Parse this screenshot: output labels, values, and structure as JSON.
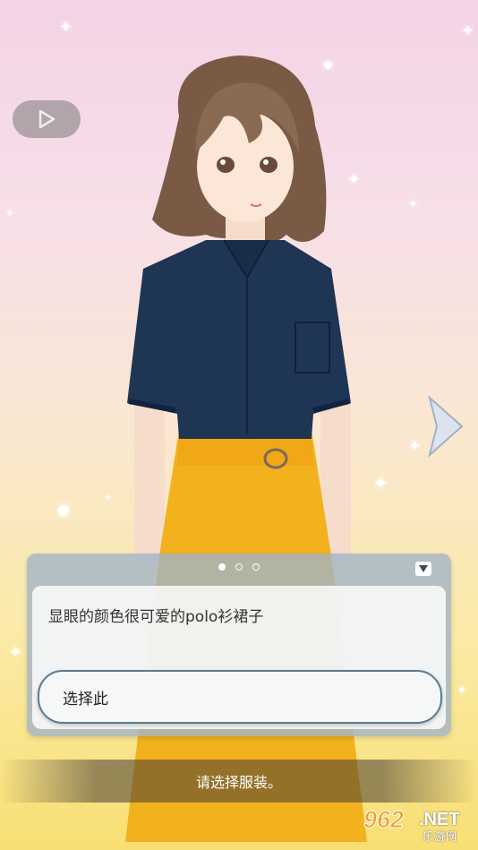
{
  "dialog": {
    "description": "显眼的颜色很可爱的polo衫裙子",
    "page_indicator": {
      "current": 1,
      "total": 3
    },
    "select_label": "选择此"
  },
  "hint": {
    "text": "请选择服装。"
  },
  "controls": {
    "play_icon": "play-icon",
    "next_icon": "chevron-right-icon",
    "collapse_icon": "triangle-down-icon"
  },
  "watermark": {
    "number": "962",
    "suffix": ".NET",
    "subtitle": "乐游网"
  },
  "colors": {
    "shirt": "#1f3554",
    "skirt": "#f2b21e",
    "dialog_border": "#5b7a92"
  }
}
